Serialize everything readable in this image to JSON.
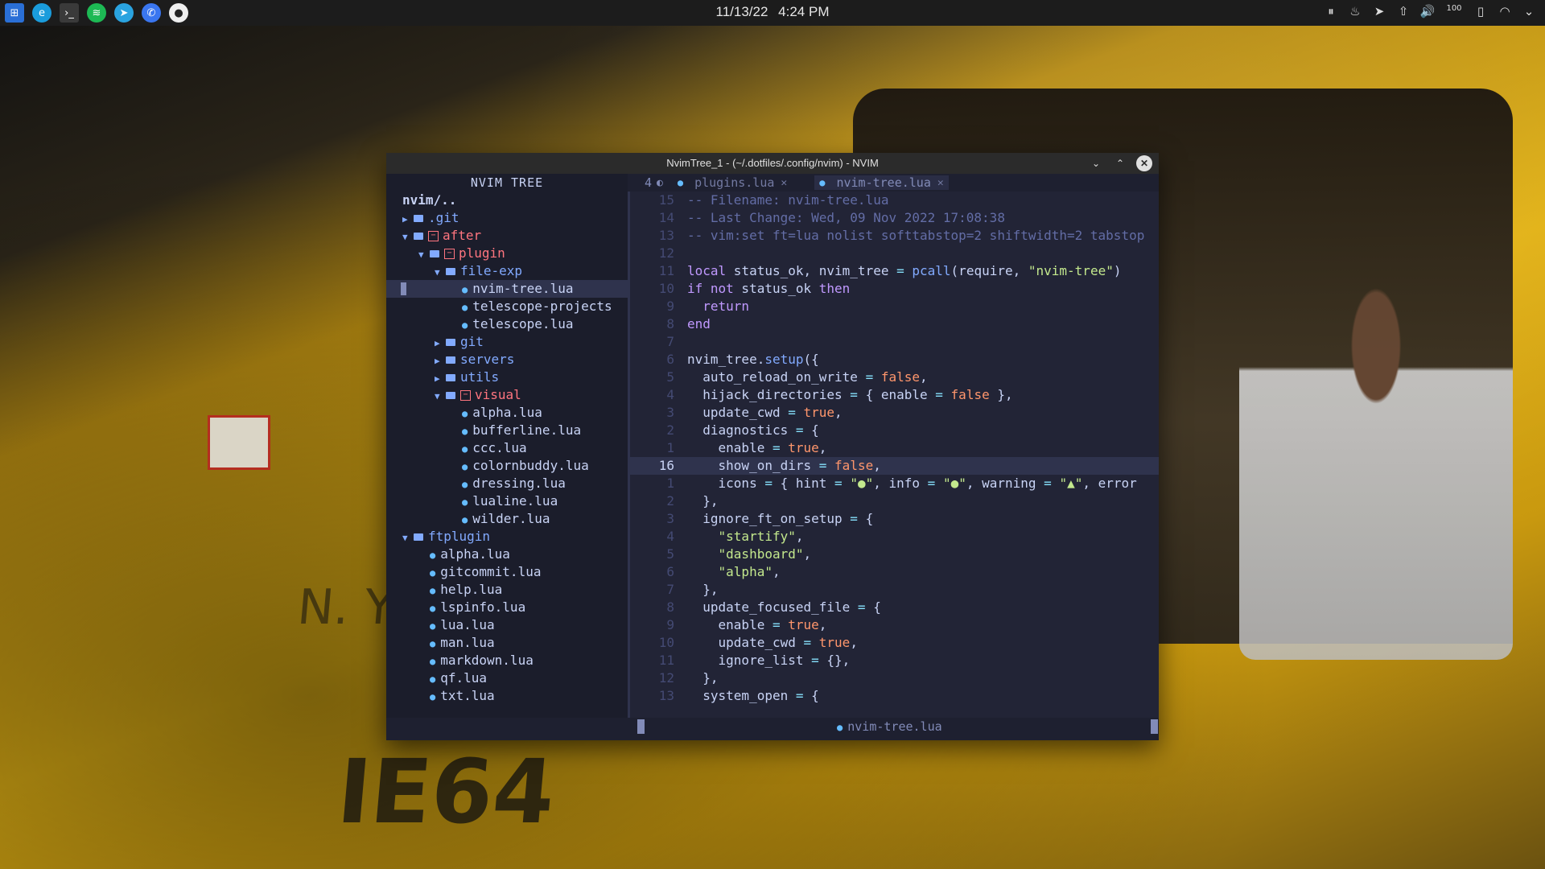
{
  "taskbar": {
    "apps": [
      "windows-start",
      "edge-browser",
      "terminal",
      "spotify",
      "telegram",
      "signal",
      "obs"
    ],
    "date": "11/13/22",
    "time": "4:24 PM",
    "tray": {
      "battery": "100"
    }
  },
  "window": {
    "title": "NvimTree_1 - (~/.dotfiles/.config/nvim) - NVIM"
  },
  "tree": {
    "title": "NVIM TREE",
    "root": "nvim/..",
    "rows": [
      {
        "label": ".git",
        "type": "folder",
        "depth": 0,
        "open": false
      },
      {
        "label": "after",
        "type": "folder",
        "depth": 0,
        "open": true,
        "mod": true
      },
      {
        "label": "plugin",
        "type": "folder",
        "depth": 1,
        "open": true,
        "mod": true
      },
      {
        "label": "file-exp",
        "type": "folder",
        "depth": 2,
        "open": true
      },
      {
        "label": "nvim-tree.lua",
        "type": "file",
        "depth": 3,
        "selected": true
      },
      {
        "label": "telescope-projects",
        "type": "file",
        "depth": 3
      },
      {
        "label": "telescope.lua",
        "type": "file",
        "depth": 3
      },
      {
        "label": "git",
        "type": "folder",
        "depth": 2,
        "open": false
      },
      {
        "label": "servers",
        "type": "folder",
        "depth": 2,
        "open": false
      },
      {
        "label": "utils",
        "type": "folder",
        "depth": 2,
        "open": false
      },
      {
        "label": "visual",
        "type": "folder",
        "depth": 2,
        "open": true,
        "mod": true
      },
      {
        "label": "alpha.lua",
        "type": "file",
        "depth": 3
      },
      {
        "label": "bufferline.lua",
        "type": "file",
        "depth": 3
      },
      {
        "label": "ccc.lua",
        "type": "file",
        "depth": 3
      },
      {
        "label": "colornbuddy.lua",
        "type": "file",
        "depth": 3
      },
      {
        "label": "dressing.lua",
        "type": "file",
        "depth": 3
      },
      {
        "label": "lualine.lua",
        "type": "file",
        "depth": 3
      },
      {
        "label": "wilder.lua",
        "type": "file",
        "depth": 3
      },
      {
        "label": "ftplugin",
        "type": "folder",
        "depth": 0,
        "open": true
      },
      {
        "label": "alpha.lua",
        "type": "file",
        "depth": 1
      },
      {
        "label": "gitcommit.lua",
        "type": "file",
        "depth": 1
      },
      {
        "label": "help.lua",
        "type": "file",
        "depth": 1
      },
      {
        "label": "lspinfo.lua",
        "type": "file",
        "depth": 1
      },
      {
        "label": "lua.lua",
        "type": "file",
        "depth": 1
      },
      {
        "label": "man.lua",
        "type": "file",
        "depth": 1
      },
      {
        "label": "markdown.lua",
        "type": "file",
        "depth": 1
      },
      {
        "label": "qf.lua",
        "type": "file",
        "depth": 1
      },
      {
        "label": "txt.lua",
        "type": "file",
        "depth": 1
      }
    ]
  },
  "editor": {
    "buffer_count": "4",
    "tabs": [
      {
        "label": "plugins.lua",
        "active": false
      },
      {
        "label": "nvim-tree.lua",
        "active": true
      }
    ],
    "lines": [
      {
        "n": "15",
        "html": "<span class=\"c\">-- Filename: nvim-tree.lua</span>"
      },
      {
        "n": "14",
        "html": "<span class=\"c\">-- Last Change: Wed, 09 Nov 2022 17:08:38</span>"
      },
      {
        "n": "13",
        "html": "<span class=\"c\">-- vim:set ft=lua nolist softtabstop=2 shiftwidth=2 tabstop</span>"
      },
      {
        "n": "12",
        "html": ""
      },
      {
        "n": "11",
        "html": "<span class=\"k\">local</span> status_ok, nvim_tree <span class=\"p\">=</span> <span class=\"f\">pcall</span>(require, <span class=\"s\">\"nvim-tree\"</span>)"
      },
      {
        "n": "10",
        "html": "<span class=\"k\">if not</span> status_ok <span class=\"k\">then</span>"
      },
      {
        "n": "9",
        "html": "  <span class=\"k\">return</span>"
      },
      {
        "n": "8",
        "html": "<span class=\"k\">end</span>"
      },
      {
        "n": "7",
        "html": ""
      },
      {
        "n": "6",
        "html": "nvim_tree.<span class=\"f\">setup</span>({"
      },
      {
        "n": "5",
        "html": "  auto_reload_on_write <span class=\"p\">=</span> <span class=\"b\">false</span>,"
      },
      {
        "n": "4",
        "html": "  hijack_directories <span class=\"p\">=</span> { enable <span class=\"p\">=</span> <span class=\"b\">false</span> },"
      },
      {
        "n": "3",
        "html": "  update_cwd <span class=\"p\">=</span> <span class=\"b\">true</span>,"
      },
      {
        "n": "2",
        "html": "  diagnostics <span class=\"p\">=</span> {"
      },
      {
        "n": "1",
        "html": "    enable <span class=\"p\">=</span> <span class=\"b\">true</span>,"
      },
      {
        "n": "16",
        "html": "    show_on_dirs <span class=\"p\">=</span> <span class=\"b\">false</span>,",
        "cursor": true
      },
      {
        "n": "1",
        "html": "    icons <span class=\"p\">=</span> { hint <span class=\"p\">=</span> <span class=\"s\">\"●\"</span>, info <span class=\"p\">=</span> <span class=\"s\">\"●\"</span>, warning <span class=\"p\">=</span> <span class=\"s\">\"▲\"</span>, error"
      },
      {
        "n": "2",
        "html": "  },"
      },
      {
        "n": "3",
        "html": "  ignore_ft_on_setup <span class=\"p\">=</span> {"
      },
      {
        "n": "4",
        "html": "    <span class=\"s\">\"startify\"</span>,"
      },
      {
        "n": "5",
        "html": "    <span class=\"s\">\"dashboard\"</span>,"
      },
      {
        "n": "6",
        "html": "    <span class=\"s\">\"alpha\"</span>,"
      },
      {
        "n": "7",
        "html": "  },"
      },
      {
        "n": "8",
        "html": "  update_focused_file <span class=\"p\">=</span> {"
      },
      {
        "n": "9",
        "html": "    enable <span class=\"p\">=</span> <span class=\"b\">true</span>,"
      },
      {
        "n": "10",
        "html": "    update_cwd <span class=\"p\">=</span> <span class=\"b\">true</span>,"
      },
      {
        "n": "11",
        "html": "    ignore_list <span class=\"p\">=</span> {},"
      },
      {
        "n": "12",
        "html": "  },"
      },
      {
        "n": "13",
        "html": "  system_open <span class=\"p\">=</span> {"
      }
    ]
  },
  "statusline": {
    "filename": "nvim-tree.lua"
  },
  "wallpaper": {
    "text1": "IE64",
    "text2": "N. Y."
  }
}
